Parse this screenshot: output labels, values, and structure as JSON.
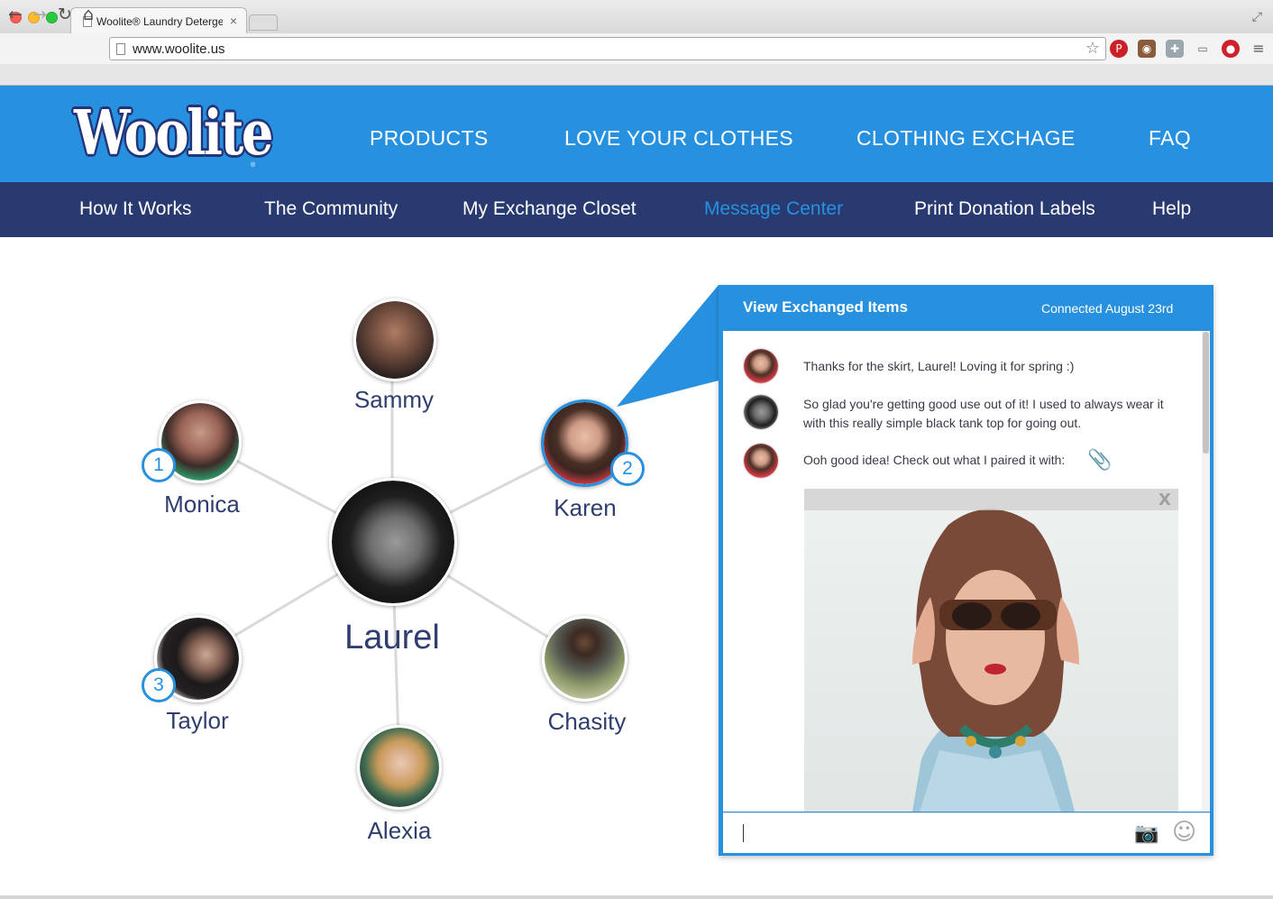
{
  "browser": {
    "tab_title": "Woolite® Laundry Deterge",
    "tab_close": "×",
    "url": "www.woolite.us"
  },
  "site": {
    "logo_text": "Woolite",
    "logo_reg": "®",
    "main_nav": [
      {
        "label": "PRODUCTS"
      },
      {
        "label": "LOVE YOUR CLOTHES"
      },
      {
        "label": "CLOTHING EXCHAGE"
      },
      {
        "label": "FAQ"
      }
    ],
    "sub_nav": [
      {
        "label": "How It Works"
      },
      {
        "label": "The Community"
      },
      {
        "label": "My Exchange Closet"
      },
      {
        "label": "Message Center",
        "active": true
      },
      {
        "label": "Print Donation Labels"
      },
      {
        "label": "Help"
      }
    ],
    "accent_color": "#2791e0",
    "navy_color": "#283a6f"
  },
  "graph": {
    "center": {
      "name": "Laurel"
    },
    "nodes": [
      {
        "name": "Sammy"
      },
      {
        "name": "Monica",
        "badge": "1"
      },
      {
        "name": "Karen",
        "badge": "2",
        "selected": true
      },
      {
        "name": "Taylor",
        "badge": "3"
      },
      {
        "name": "Chasity"
      },
      {
        "name": "Alexia"
      }
    ]
  },
  "chat": {
    "title": "View Exchanged Items",
    "connected": "Connected August 23rd",
    "messages": [
      {
        "sender": "Karen",
        "text": "Thanks for the skirt, Laurel! Loving it for spring :)"
      },
      {
        "sender": "Laurel",
        "text": "So glad you're getting good use out of it! I used to always wear it with this really simple black tank top for going out."
      },
      {
        "sender": "Karen",
        "text": "Ooh good idea! Check out what I paired it with:"
      }
    ],
    "attachment_close": "X",
    "input_value": ""
  }
}
